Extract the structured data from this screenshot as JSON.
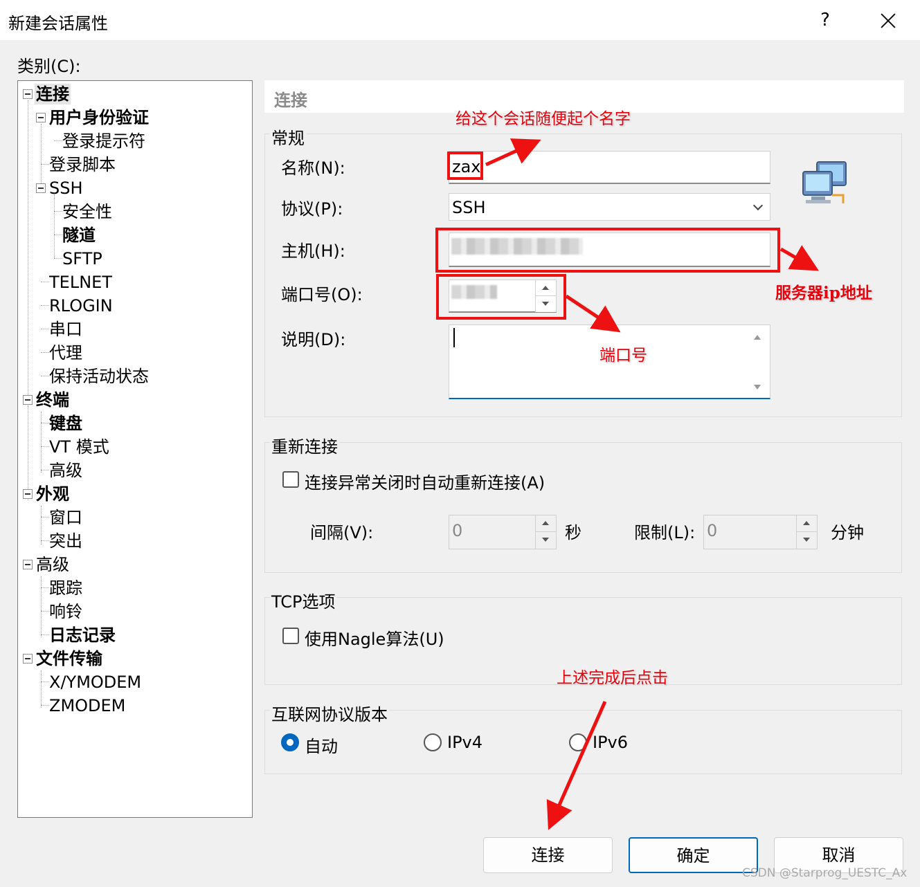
{
  "window": {
    "title": "新建会话属性",
    "help": "?"
  },
  "category_label": "类别(C):",
  "tree": {
    "items": [
      {
        "label": "连接"
      },
      {
        "label": "用户身份验证"
      },
      {
        "label": "登录提示符"
      },
      {
        "label": "登录脚本"
      },
      {
        "label": "SSH"
      },
      {
        "label": "安全性"
      },
      {
        "label": "隧道"
      },
      {
        "label": "SFTP"
      },
      {
        "label": "TELNET"
      },
      {
        "label": "RLOGIN"
      },
      {
        "label": "串口"
      },
      {
        "label": "代理"
      },
      {
        "label": "保持活动状态"
      },
      {
        "label": "终端"
      },
      {
        "label": "键盘"
      },
      {
        "label": "VT 模式"
      },
      {
        "label": "高级"
      },
      {
        "label": "外观"
      },
      {
        "label": "窗口"
      },
      {
        "label": "突出"
      },
      {
        "label": "高级"
      },
      {
        "label": "跟踪"
      },
      {
        "label": "响铃"
      },
      {
        "label": "日志记录"
      },
      {
        "label": "文件传输"
      },
      {
        "label": "X/YMODEM"
      },
      {
        "label": "ZMODEM"
      }
    ]
  },
  "section_title": "连接",
  "general": {
    "title": "常规",
    "name_label": "名称(N):",
    "name_value": "zax",
    "protocol_label": "协议(P):",
    "protocol_value": "SSH",
    "host_label": "主机(H):",
    "host_value": "",
    "port_label": "端口号(O):",
    "port_value": "",
    "desc_label": "说明(D):",
    "desc_value": ""
  },
  "reconnect": {
    "title": "重新连接",
    "checkbox_label": "连接异常关闭时自动重新连接(A)",
    "checked": false,
    "interval_label": "间隔(V):",
    "interval_value": "0",
    "interval_unit": "秒",
    "limit_label": "限制(L):",
    "limit_value": "0",
    "limit_unit": "分钟"
  },
  "tcp": {
    "title": "TCP选项",
    "nagle_label": "使用Nagle算法(U)",
    "checked": false
  },
  "ip_version": {
    "title": "互联网协议版本",
    "options": [
      {
        "label": "自动"
      },
      {
        "label": "IPv4"
      },
      {
        "label": "IPv6"
      }
    ],
    "selected": "自动"
  },
  "buttons": {
    "connect": "连接",
    "ok": "确定",
    "cancel": "取消"
  },
  "annotations": {
    "name_hint": "给这个会话随便起个名字",
    "host_hint": "服务器ip地址",
    "port_hint": "端口号",
    "click_hint": "上述完成后点击"
  },
  "watermark": "CSDN @Starprog_UESTC_Ax",
  "colors": {
    "accent": "#0067c0",
    "annotation": "#ee1111"
  }
}
